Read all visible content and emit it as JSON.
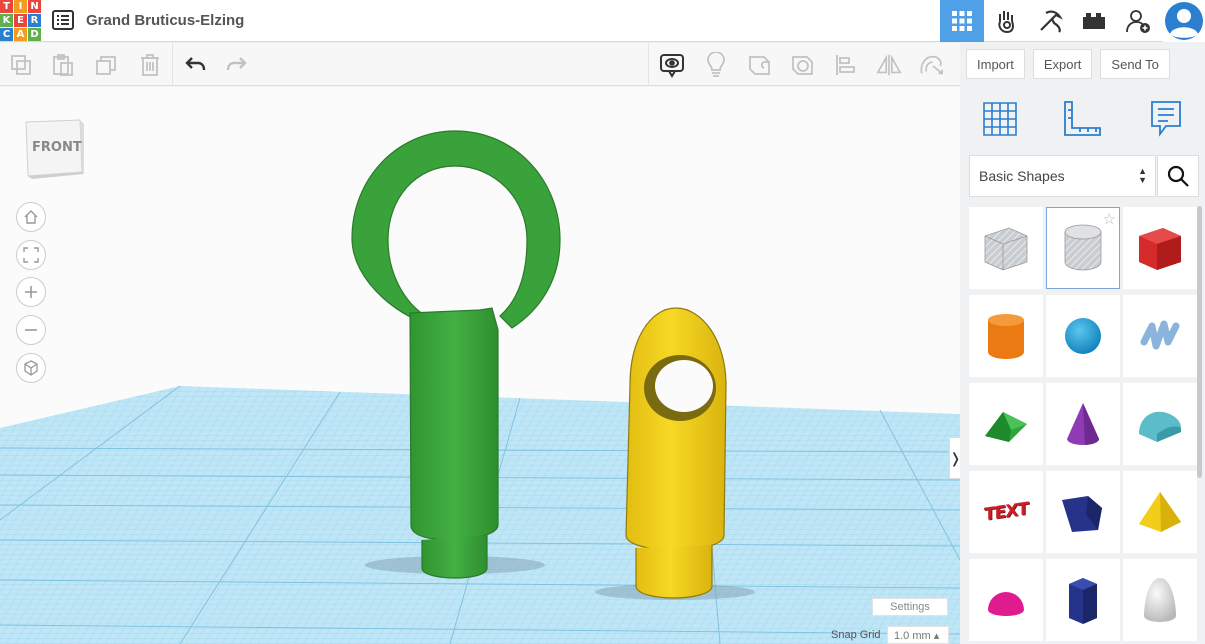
{
  "app": {
    "logo_letters": [
      "T",
      "I",
      "N",
      "K",
      "E",
      "R",
      "C",
      "A",
      "D"
    ],
    "logo_colors": [
      "#e8473f",
      "#f59b1d",
      "#e8473f",
      "#5fb04a",
      "#e8473f",
      "#2b7fcf",
      "#2b7fcf",
      "#f59b1d",
      "#5fb04a"
    ],
    "design_title": "Grand Bruticus-Elzing"
  },
  "header": {
    "icons": [
      "grid-view-icon",
      "hand-sim-icon",
      "pickaxe-icon",
      "bricks-icon",
      "add-user-icon"
    ],
    "active_color": "#4fa0e6"
  },
  "toolbar": {
    "actions": [
      "copy-icon",
      "paste-icon",
      "duplicate-icon",
      "delete-icon",
      "undo-icon",
      "redo-icon"
    ],
    "view_tools": [
      "notes-icon",
      "light-bulb-icon",
      "shape-solid-icon",
      "shape-hole-icon",
      "align-icon",
      "mirror-icon",
      "cruise-icon"
    ]
  },
  "right_tools": {
    "import_label": "Import",
    "export_label": "Export",
    "send_label": "Send To"
  },
  "viewport": {
    "viewcube_label": "FRONT",
    "settings_label": "Settings",
    "snap_grid_label": "Snap Grid",
    "snap_grid_value": "1.0 mm ▴"
  },
  "panel": {
    "category": "Basic Shapes",
    "shapes": [
      {
        "name": "box-hole",
        "color": "#bfc3c8"
      },
      {
        "name": "cylinder-hole",
        "color": "#bfc3c8"
      },
      {
        "name": "box",
        "color": "#d42a2a"
      },
      {
        "name": "cylinder",
        "color": "#f07f15"
      },
      {
        "name": "sphere",
        "color": "#1a9ad6"
      },
      {
        "name": "scribble",
        "color": "#8ab4dc"
      },
      {
        "name": "roof",
        "color": "#2da83a"
      },
      {
        "name": "cone",
        "color": "#8e3bb5"
      },
      {
        "name": "round-roof",
        "color": "#5bbdc9"
      },
      {
        "name": "text",
        "color": "#c8202a"
      },
      {
        "name": "wedge",
        "color": "#25348a"
      },
      {
        "name": "pyramid",
        "color": "#f2cd1a"
      },
      {
        "name": "half-sphere",
        "color": "#e01a8f"
      },
      {
        "name": "polygon",
        "color": "#25348a"
      },
      {
        "name": "paraboloid",
        "color": "#d6d6d6"
      }
    ],
    "text_shape_label": "TEXT"
  },
  "scene": {
    "objects": [
      {
        "name": "green-keyring-handle",
        "color": "#3aa23a"
      },
      {
        "name": "yellow-keychain-plug",
        "color": "#f2d01a"
      }
    ],
    "grid_color": "#a9dbf2"
  }
}
